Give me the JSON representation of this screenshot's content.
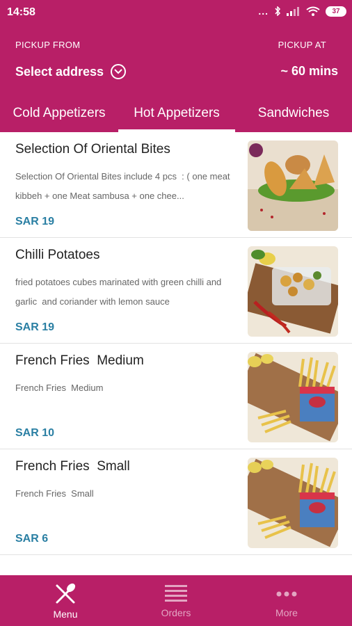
{
  "status_bar": {
    "time": "14:58",
    "battery": "37",
    "dots": "..."
  },
  "header": {
    "pickup_from_label": "PICKUP FROM",
    "pickup_at_label": "PICKUP AT",
    "select_address": "Select address",
    "pickup_time": "~ 60 mins"
  },
  "tabs": [
    {
      "label": "Cold Appetizers",
      "selected": false
    },
    {
      "label": "Hot Appetizers",
      "selected": true
    },
    {
      "label": "Sandwiches",
      "selected": false
    }
  ],
  "items": [
    {
      "name": "Selection Of Oriental Bites",
      "description": "Selection Of Oriental Bites include 4 pcs  : ( one meat kibbeh + one Meat sambusa + one chee...",
      "price": "SAR 19"
    },
    {
      "name": "Chilli Potatoes",
      "description": "fried potatoes cubes marinated with green chilli and garlic  and coriander with lemon sauce",
      "price": "SAR 19"
    },
    {
      "name": "French Fries  Medium",
      "description": "French Fries  Medium",
      "price": "SAR 10"
    },
    {
      "name": "French Fries  Small",
      "description": "French Fries  Small",
      "price": "SAR 6"
    }
  ],
  "bottom_nav": [
    {
      "label": "Menu",
      "icon": "fork-spoon-icon",
      "active": true
    },
    {
      "label": "Orders",
      "icon": "list-icon",
      "active": false
    },
    {
      "label": "More",
      "icon": "more-dots-icon",
      "active": false
    }
  ],
  "colors": {
    "brand": "#b81f67",
    "price": "#2a7fa3"
  }
}
